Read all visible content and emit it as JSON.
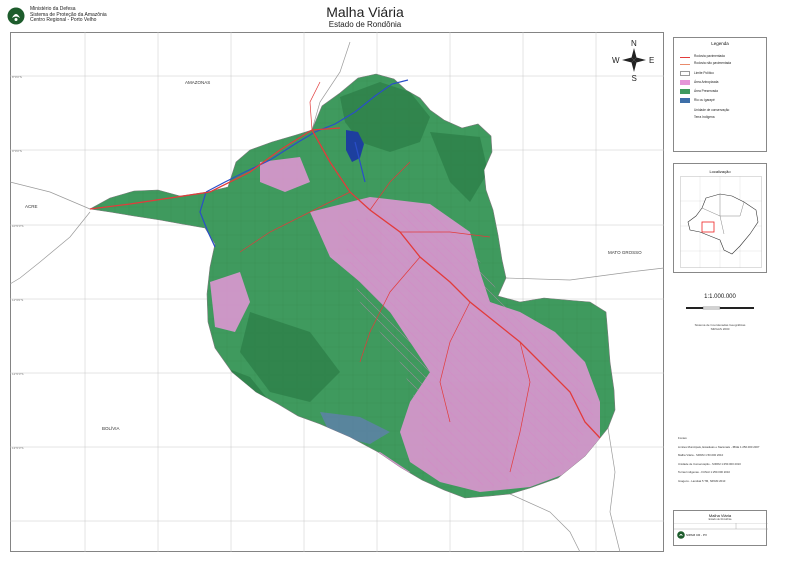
{
  "header": {
    "org_lines": [
      "Ministério da Defesa",
      "Sistema de Proteção da Amazônia",
      "Centro Regional - Porto Velho"
    ],
    "title": "Malha Viária",
    "subtitle": "Estado de Rondônia"
  },
  "map": {
    "place_labels": {
      "amazonas": "AMAZONAS",
      "acre": "ACRE",
      "mato_grosso": "MATO GROSSO",
      "bolivia": "BOLÍVIA"
    },
    "compass": {
      "n": "N",
      "s": "S",
      "e": "E",
      "w": "W"
    },
    "lat_labels": [
      "8°0'0\"S",
      "9°0'0\"S",
      "10°0'0\"S",
      "11°0'0\"S",
      "12°0'0\"S",
      "13°0'0\"S"
    ],
    "colors": {
      "forest": "#3f9a5e",
      "anthropized": "#e596d8",
      "water": "#1d3f9e",
      "road": "#e23b3b",
      "border": "#8a8a8a"
    }
  },
  "legend": {
    "title": "Legenda",
    "items": [
      {
        "label": "Rodovia pavimentada",
        "kind": "line",
        "color": "#e23b3b"
      },
      {
        "label": "Rodovia não pavimentada",
        "kind": "line",
        "color": "#e98b6b"
      },
      {
        "label": "Limite Político",
        "kind": "box",
        "color": "#ffffff"
      },
      {
        "label": "Área Antropizada",
        "kind": "box",
        "color": "#e596d8"
      },
      {
        "label": "Área Preservada",
        "kind": "box",
        "color": "#3f9a5e"
      },
      {
        "label": "Rio ou igarapé",
        "kind": "box",
        "color": "#3e6fa8"
      },
      {
        "label": "Unidade de conservação",
        "kind": "none",
        "color": ""
      },
      {
        "label": "Terra Indígena",
        "kind": "none",
        "color": ""
      }
    ]
  },
  "inset": {
    "title": "Localização"
  },
  "scale": {
    "label": "1:1.000.000",
    "note_lines": [
      "Sistema de Coordenadas Geográficas",
      "SIRGAS 2000"
    ]
  },
  "sources": [
    "Fontes:",
    "Limites Municipais, Estaduais e Nacionais - IBGE 1:250.000 2007",
    "Malha Viária - SIPAM 1:50.000 2010",
    "Unidade de Conservação - SIPAM 1:250.000 2010",
    "Terras Indígenas - FUNAI 1:250.000 2010",
    "Imagens - Landsat 5 TM, SIPAM 2010"
  ],
  "title_block": {
    "title": "Malha Viária",
    "subtitle": "Estado de Rondônia",
    "org": "SIPAM CR - PV"
  }
}
